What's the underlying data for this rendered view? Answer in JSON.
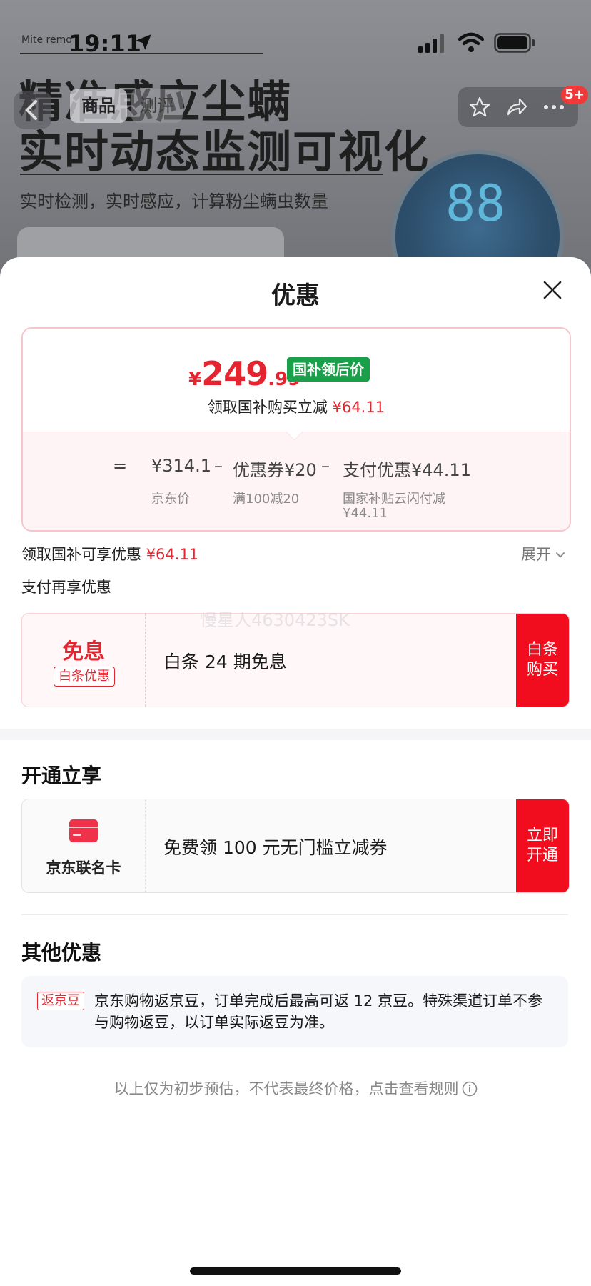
{
  "status_bar": {
    "time": "19:11"
  },
  "background_page": {
    "brand": "Mite remo",
    "hero_line1": "精准感应尘螨",
    "hero_line2": "实时动态监测可视化",
    "subtitle": "实时检测，实时感应，计算粉尘螨虫数量",
    "device_reading": "88",
    "nav": {
      "tab_goods": "商品",
      "tab_review": "测评",
      "badge": "5+"
    }
  },
  "sheet": {
    "title": "优惠",
    "price_card": {
      "currency": "¥",
      "price_int": "249",
      "price_dec": ".99",
      "tag": "国补领后价",
      "sub_prefix": "领取国补购买立减",
      "sub_amount": "¥64.11",
      "calc_equals": "=",
      "jd_price": "¥314.1",
      "minus1": "–",
      "coupon": "优惠券¥20",
      "minus2": "–",
      "pay_discount": "支付优惠¥44.11",
      "jd_price_note": "京东价",
      "coupon_note": "满100减20",
      "pay_note_line1": "国家补贴云闪付减",
      "pay_note_line2": "¥44.11"
    },
    "claim": {
      "label": "领取国补可享优惠",
      "amount": "¥64.11",
      "expand": "展开"
    },
    "pay_more": "支付再享优惠",
    "watermark": "慢星人4630423SK",
    "baitiao": {
      "big": "免息",
      "chip": "白条优惠",
      "text": "白条 24 期免息",
      "button_line1": "白条",
      "button_line2": "购买"
    },
    "open_section": {
      "title": "开通立享",
      "card_label": "京东联名卡",
      "text": "免费领 100 元无门槛立减券",
      "button_line1": "立即",
      "button_line2": "开通"
    },
    "other_section": {
      "title": "其他优惠",
      "bean_tag": "返京豆",
      "bean_text": "京东购物返京豆，订单完成后最高可返 12 京豆。特殊渠道订单不参与购物返豆，以订单实际返豆为准。"
    },
    "footer_note": "以上仅为初步预估，不代表最终价格，点击查看规则"
  },
  "colors": {
    "accent": "#e4252f",
    "button_red": "#f10d1e",
    "tag_green": "#1aa04a"
  },
  "icons": [
    "location-arrow-icon",
    "signal-icon",
    "wifi-icon",
    "battery-icon",
    "back-arrow-icon",
    "star-icon",
    "share-icon",
    "more-icon",
    "close-icon",
    "chevron-down-icon",
    "credit-card-icon",
    "info-icon"
  ]
}
